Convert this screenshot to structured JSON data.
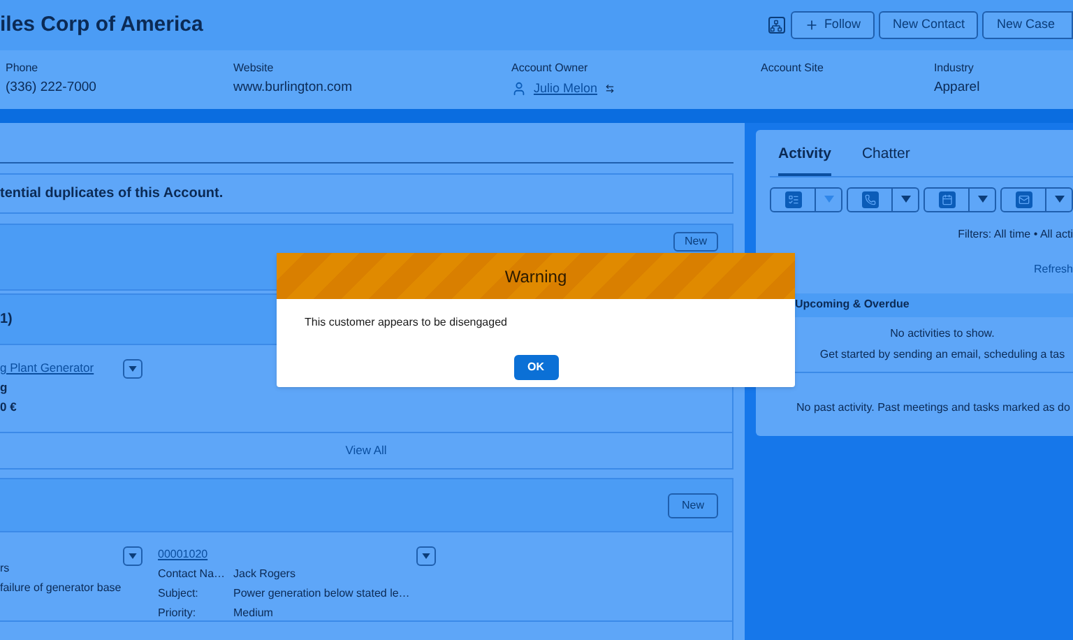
{
  "header": {
    "title": "iles Corp of America",
    "actions": [
      {
        "label": "Follow",
        "kind": "follow"
      },
      {
        "label": "New Contact",
        "kind": "plain"
      },
      {
        "label": "New Case",
        "kind": "plain"
      }
    ]
  },
  "highlights": [
    {
      "label": "Phone",
      "value": "(336) 222-7000",
      "kind": "text"
    },
    {
      "label": "Website",
      "value": "www.burlington.com",
      "kind": "text"
    },
    {
      "label": "Account Owner",
      "value": "Julio Melon",
      "kind": "user"
    },
    {
      "label": "Account Site"
    },
    {
      "label": "Industry",
      "value": "Apparel",
      "kind": "text"
    }
  ],
  "duplicates_notice": "tential duplicates of this Account.",
  "related_list": {
    "button": "New"
  },
  "opportunities": {
    "title": "1)",
    "item": {
      "name": "g Plant Generator",
      "line_2": "g",
      "line_3": "0 €"
    },
    "view_all": "View All"
  },
  "cases": {
    "button": "New",
    "first_item": [
      "rs",
      "failure of generator base"
    ],
    "second_item": {
      "number": "00001020",
      "fields": [
        {
          "label": "Contact Na…",
          "value": "Jack Rogers"
        },
        {
          "label": "Subject:",
          "value": "Power generation below stated le…"
        },
        {
          "label": "Priority:",
          "value": "Medium"
        }
      ]
    }
  },
  "activity_panel": {
    "tabs": [
      {
        "label": "Activity",
        "selected": true
      },
      {
        "label": "Chatter",
        "selected": false
      }
    ],
    "filters": "Filters: All time • All acti",
    "refresh": "Refresh",
    "upcoming": {
      "title": "Upcoming & Overdue",
      "empty": "No activities to show.",
      "hint": "Get started by sending an email, scheduling a tas"
    },
    "past": "No past activity. Past meetings and tasks marked as do"
  },
  "dialog": {
    "title": "Warning",
    "message": "This customer appears to be disengaged",
    "button": "OK"
  }
}
